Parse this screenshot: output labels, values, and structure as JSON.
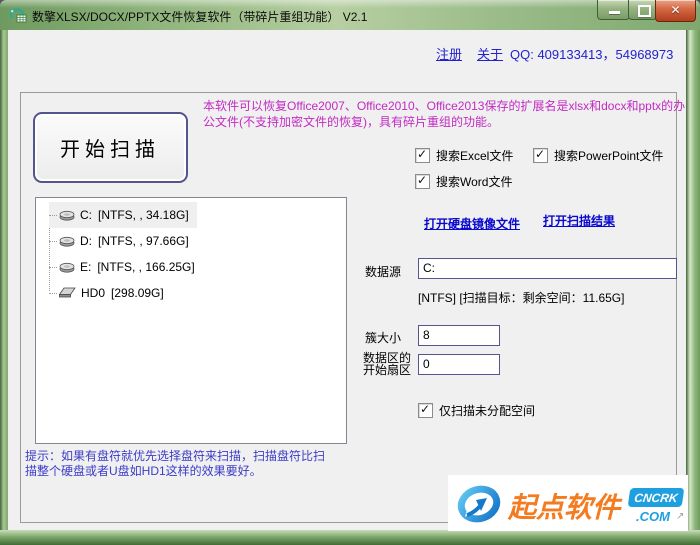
{
  "window": {
    "title": "数擎XLSX/DOCX/PPTX文件恢复软件（带碎片重组功能） V2.1",
    "controls": [
      "minimize-icon",
      "maximize-icon",
      "close-icon"
    ]
  },
  "header": {
    "register": "注册",
    "about": "关于",
    "qq": "QQ: 409133413，54968973"
  },
  "main": {
    "scan_button": "开始扫描",
    "description": {
      "line1": "本软件可以恢复Office2007、Office2010、Office2013保存的扩展名是xlsx和docx和pptx的办",
      "line2": "公文件(不支持加密文件的恢复)，具有碎片重组的功能。"
    },
    "search": {
      "excel": "搜索Excel文件",
      "powerpoint": "搜索PowerPoint文件",
      "word": "搜索Word文件"
    },
    "links": {
      "open_image": "打开硬盘镜像文件",
      "open_result": "打开扫描结果"
    },
    "data_source": {
      "label": "数据源",
      "value": "C:",
      "status": "[NTFS] [扫描目标：剩余空间：11.65G]"
    },
    "cluster": {
      "label": "簇大小",
      "value": "8"
    },
    "sector": {
      "label1": "数据区的",
      "label2": "开始扇区",
      "value": "0"
    },
    "unallocated": "仅扫描未分配空间",
    "drives": [
      {
        "name": "C:",
        "info": "[NTFS, , 34.18G]",
        "selected": true,
        "icon": "partition-icon"
      },
      {
        "name": "D:",
        "info": "[NTFS, , 97.66G]",
        "selected": false,
        "icon": "partition-icon"
      },
      {
        "name": "E:",
        "info": "[NTFS, , 166.25G]",
        "selected": false,
        "icon": "partition-icon"
      },
      {
        "name": "HD0",
        "info": "[298.09G]",
        "selected": false,
        "icon": "harddisk-icon"
      }
    ],
    "hint": {
      "line1": "提示：如果有盘符就优先选择盘符来扫描，扫描盘符比扫",
      "line2": "描整个硬盘或者U盘如HD1这样的效果要好。"
    }
  },
  "watermark": {
    "brand": "起点软件",
    "badge": "CNCRK",
    "domain": ".COM",
    "mark": "↗",
    "logo_icon": "swirl-arrow-logo"
  },
  "colors": {
    "frame_green": "#7FA86C",
    "description_magenta": "#C32AC3",
    "hint_blue": "#3C3CC8",
    "link_blue": "#2323CE",
    "action_link_blue": "#0909CF",
    "input_border": "#54548E",
    "brand_orange": "#F47B20",
    "logo_blue": "#1E9FE0",
    "close_button_red": "#B03F1E"
  }
}
